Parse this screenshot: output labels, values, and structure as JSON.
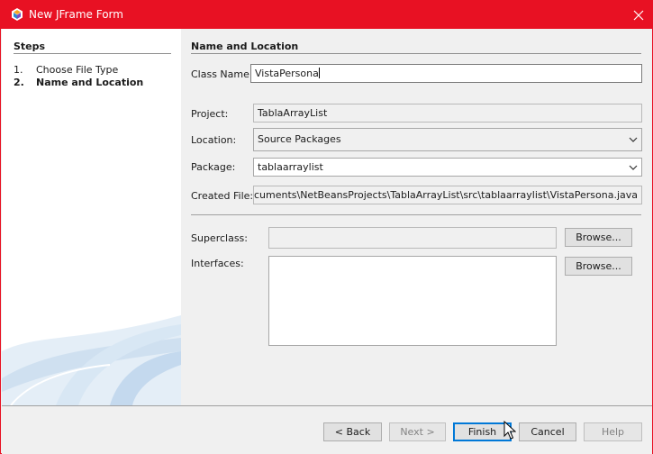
{
  "window": {
    "title": "New JFrame Form",
    "accent": "#e81123"
  },
  "steps": {
    "heading": "Steps",
    "items": [
      {
        "num": "1.",
        "label": "Choose File Type"
      },
      {
        "num": "2.",
        "label": "Name and Location"
      }
    ],
    "current_index": 1
  },
  "form": {
    "heading": "Name and Location",
    "class_name": {
      "label": "Class Name:",
      "value": "VistaPersona"
    },
    "project": {
      "label": "Project:",
      "value": "TablaArrayList"
    },
    "location": {
      "label": "Location:",
      "value": "Source Packages"
    },
    "package": {
      "label": "Package:",
      "value": "tablaarraylist"
    },
    "created_file": {
      "label": "Created File:",
      "value": "Dyson\\Documents\\NetBeansProjects\\TablaArrayList\\src\\tablaarraylist\\VistaPersona.java"
    },
    "superclass": {
      "label": "Superclass:",
      "value": "",
      "browse": "Browse..."
    },
    "interfaces": {
      "label": "Interfaces:",
      "browse": "Browse..."
    }
  },
  "buttons": {
    "back": "< Back",
    "next": "Next >",
    "finish": "Finish",
    "cancel": "Cancel",
    "help": "Help"
  },
  "icons": {
    "app": "netbeans-logo-icon",
    "close": "close-icon",
    "dropdown": "chevron-down-icon",
    "cursor": "mouse-pointer-icon"
  }
}
